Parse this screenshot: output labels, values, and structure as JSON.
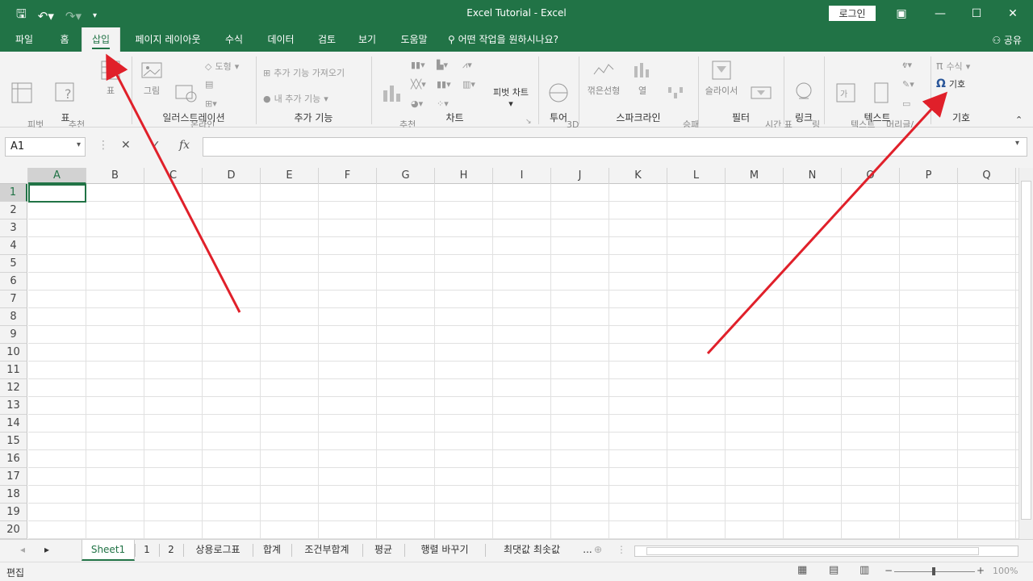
{
  "titlebar": {
    "doc_title": "Excel Tutorial  -  Excel",
    "login": "로그인",
    "qat": {
      "save_icon": "save-icon",
      "undo_icon": "undo-icon",
      "redo_icon": "redo-icon",
      "customize": "▾"
    }
  },
  "tabs": [
    {
      "label": "파일"
    },
    {
      "label": "홈"
    },
    {
      "label": "삽입",
      "active": true
    },
    {
      "label": "페이지 레이아웃"
    },
    {
      "label": "수식"
    },
    {
      "label": "데이터"
    },
    {
      "label": "검토"
    },
    {
      "label": "보기"
    },
    {
      "label": "도움말"
    },
    {
      "label": "어떤 작업을 원하시나요?"
    }
  ],
  "share": "공유",
  "ribbon": {
    "groups": {
      "table": "표",
      "illust": "일러스트레이션",
      "addins": "추가 기능",
      "charts": "차트",
      "tours": "투어",
      "spark": "스파크라인",
      "filter": "필터",
      "link": "링크",
      "text": "텍스트",
      "symbols": "기호"
    },
    "pivot": "피벗\n테이블",
    "recpivot": "추천\n피벗 테이블",
    "table": "표",
    "picture": "그림",
    "online": "온라인\n그림",
    "shapes": "도형",
    "getaddins": "추가 기능 가져오기",
    "myaddins": "내 추가 기능",
    "recchart": "추천\n차트",
    "pivotchart": "피벗 차트",
    "map3d": "3D\n맵",
    "line": "꺾은선형",
    "column": "열",
    "winloss": "승패\n(W)",
    "slicer": "슬라이서",
    "timeline": "시간 표\n시 막대",
    "link": "링\n크",
    "textbox": "텍스트\n상자",
    "headerfooter": "머리글/\n바닥글",
    "equation": "수식",
    "symbol": "기호"
  },
  "formula": {
    "namebox": "A1",
    "fx": "fx",
    "cancel": "✕",
    "enter": "✓"
  },
  "columns": [
    "A",
    "B",
    "C",
    "D",
    "E",
    "F",
    "G",
    "H",
    "I",
    "J",
    "K",
    "L",
    "M",
    "N",
    "O",
    "P",
    "Q"
  ],
  "rows": [
    "1",
    "2",
    "3",
    "4",
    "5",
    "6",
    "7",
    "8",
    "9",
    "10",
    "11",
    "12",
    "13",
    "14",
    "15",
    "16",
    "17",
    "18",
    "19",
    "20"
  ],
  "sheets": [
    "Sheet1",
    "1",
    "2",
    "상용로그표",
    "합계",
    "조건부합계",
    "평균",
    "행렬 바꾸기",
    "최댓값 최솟값",
    "..."
  ],
  "status": {
    "mode": "편집",
    "zoom": "100%",
    "minus": "−",
    "plus": "+"
  }
}
